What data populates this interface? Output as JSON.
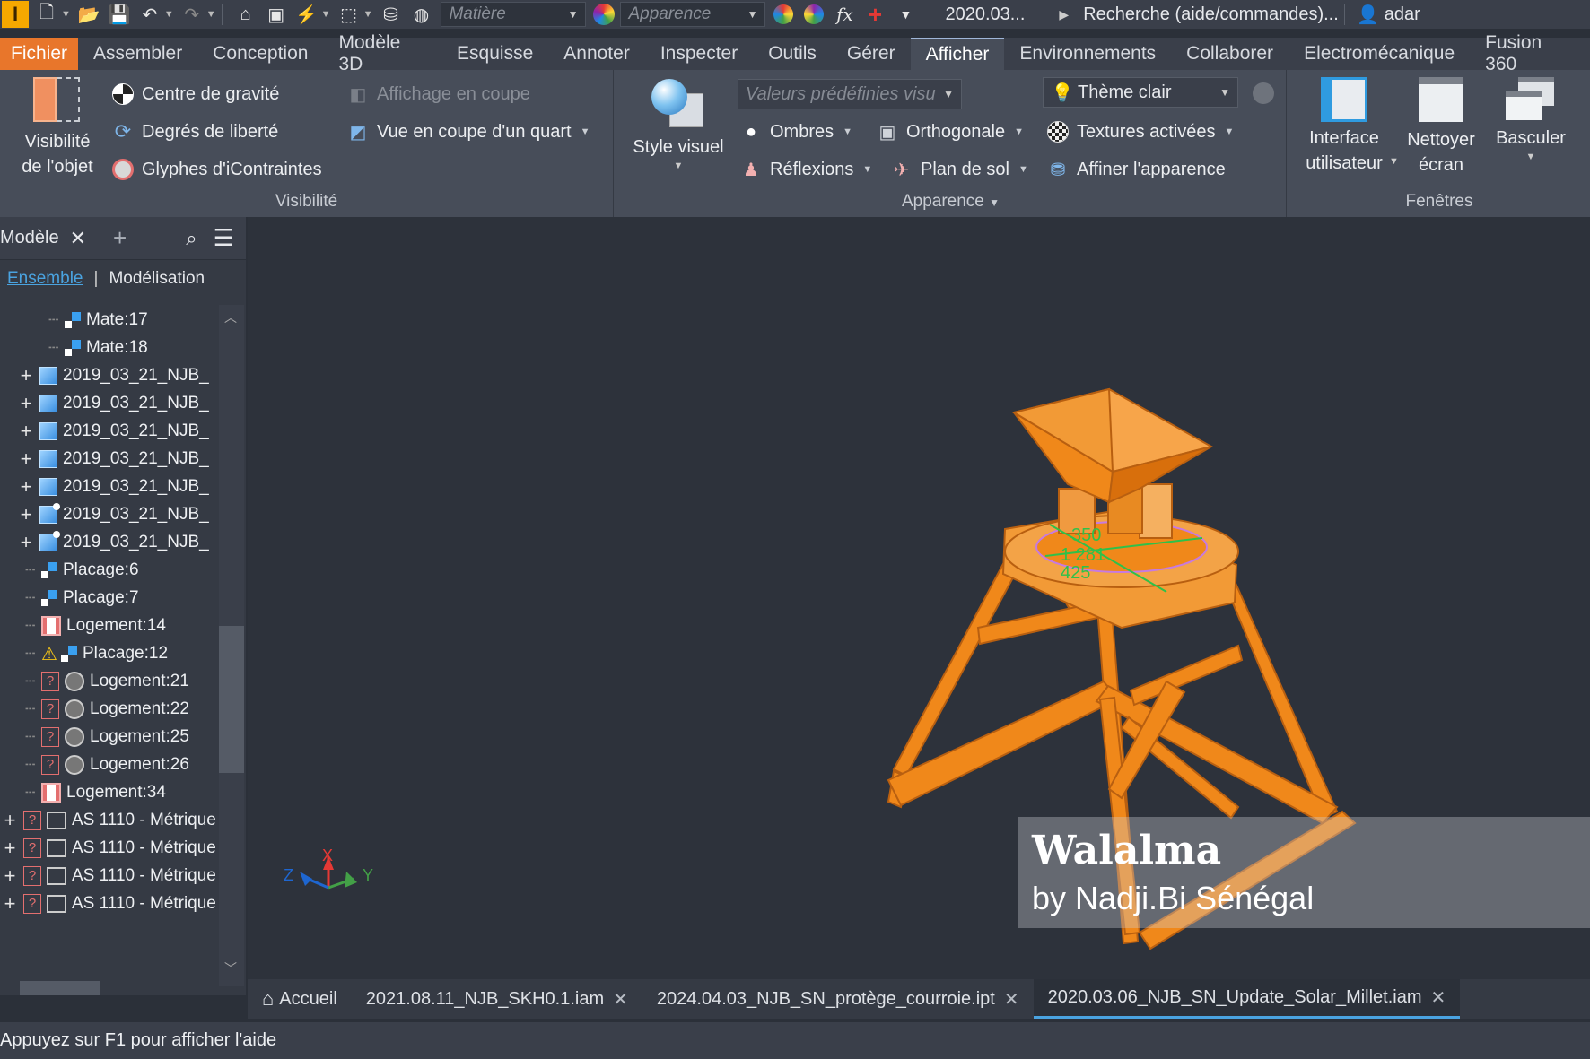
{
  "qat": {
    "app_logo": "I",
    "material_placeholder": "Matière",
    "appearance_placeholder": "Apparence",
    "file_label": "2020.03...",
    "search_label": "Recherche (aide/commandes)...",
    "user_label": "adar"
  },
  "tabs": [
    "Fichier",
    "Assembler",
    "Conception",
    "Modèle 3D",
    "Esquisse",
    "Annoter",
    "Inspecter",
    "Outils",
    "Gérer",
    "Afficher",
    "Environnements",
    "Collaborer",
    "Electromécanique",
    "Fusion 360"
  ],
  "active_tab": "Afficher",
  "ribbon": {
    "visibility": {
      "big_button": [
        "Visibilité",
        "de l'objet"
      ],
      "center_gravity": "Centre de gravité",
      "dof": "Degrés de liberté",
      "glyphs": "Glyphes d'iContraintes",
      "section_view": "Affichage en coupe",
      "quarter_section": "Vue en coupe d'un quart",
      "label": "Visibilité"
    },
    "appearance": {
      "visual_style": "Style visuel",
      "presets_placeholder": "Valeurs prédéfinies visu",
      "theme": "Thème clair",
      "shadows": "Ombres",
      "orthographic": "Orthogonale",
      "textures": "Textures activées",
      "reflections": "Réflexions",
      "ground_plane": "Plan de sol",
      "refine": "Affiner l'apparence",
      "label": "Apparence"
    },
    "windows": {
      "ui": [
        "Interface",
        "utilisateur"
      ],
      "clean": [
        "Nettoyer",
        "écran"
      ],
      "switch": "Basculer",
      "label": "Fenêtres"
    }
  },
  "browser": {
    "title": "Modèle",
    "tab_assembly": "Ensemble",
    "tab_modeling": "Modélisation",
    "items": [
      {
        "label": "Mate:17",
        "icon": "mate-icon",
        "indent": 2
      },
      {
        "label": "Mate:18",
        "icon": "mate-icon",
        "indent": 2
      },
      {
        "label": "2019_03_21_NJB_",
        "icon": "part-icon",
        "indent": 1,
        "expandable": true
      },
      {
        "label": "2019_03_21_NJB_",
        "icon": "part-icon",
        "indent": 1,
        "expandable": true
      },
      {
        "label": "2019_03_21_NJB_",
        "icon": "part-icon",
        "indent": 1,
        "expandable": true
      },
      {
        "label": "2019_03_21_NJB_",
        "icon": "part-icon",
        "indent": 1,
        "expandable": true
      },
      {
        "label": "2019_03_21_NJB_",
        "icon": "part-icon",
        "indent": 1,
        "expandable": true
      },
      {
        "label": "2019_03_21_NJB_",
        "icon": "part-pinned-icon",
        "indent": 1,
        "expandable": true
      },
      {
        "label": "2019_03_21_NJB_",
        "icon": "part-pinned-icon",
        "indent": 1,
        "expandable": true
      },
      {
        "label": "Placage:6",
        "icon": "mate-icon",
        "indent": 1
      },
      {
        "label": "Placage:7",
        "icon": "mate-icon",
        "indent": 1
      },
      {
        "label": "Logement:14",
        "icon": "housing-icon",
        "indent": 1
      },
      {
        "label": "Placage:12",
        "icon": "warning-mate-icon",
        "indent": 1
      },
      {
        "label": "Logement:21",
        "icon": "unknown-housing-icon",
        "indent": 1
      },
      {
        "label": "Logement:22",
        "icon": "unknown-housing-icon",
        "indent": 1
      },
      {
        "label": "Logement:25",
        "icon": "unknown-housing-icon",
        "indent": 1
      },
      {
        "label": "Logement:26",
        "icon": "unknown-housing-icon",
        "indent": 1
      },
      {
        "label": "Logement:34",
        "icon": "housing-icon",
        "indent": 1
      },
      {
        "label": "AS 1110 - Métrique",
        "icon": "unknown-box-icon",
        "indent": 0,
        "expandable": true
      },
      {
        "label": "AS 1110 - Métrique",
        "icon": "unknown-box-icon",
        "indent": 0,
        "expandable": true
      },
      {
        "label": "AS 1110 - Métrique",
        "icon": "unknown-box-icon",
        "indent": 0,
        "expandable": true
      },
      {
        "label": "AS 1110 - Métrique",
        "icon": "unknown-box-icon",
        "indent": 0,
        "expandable": true
      }
    ]
  },
  "viewport": {
    "dim_labels": [
      "350",
      "1 281",
      "425"
    ],
    "watermark_title": "Walalma",
    "watermark_sub": "by Nadji.Bi Sénégal",
    "triad": {
      "x": "X",
      "y": "Y",
      "z": "Z"
    }
  },
  "doc_tabs": {
    "home": "Accueil",
    "files": [
      "2021.08.11_NJB_SKH0.1.iam",
      "2024.04.03_NJB_SN_protège_courroie.ipt",
      "2020.03.06_NJB_SN_Update_Solar_Millet.iam"
    ],
    "active": "2020.03.06_NJB_SN_Update_Solar_Millet.iam"
  },
  "status": "Appuyez sur F1 pour afficher l'aide",
  "colors": {
    "model": "#f0881a",
    "file_tab": "#e8762b",
    "accent": "#4aa3e0"
  }
}
